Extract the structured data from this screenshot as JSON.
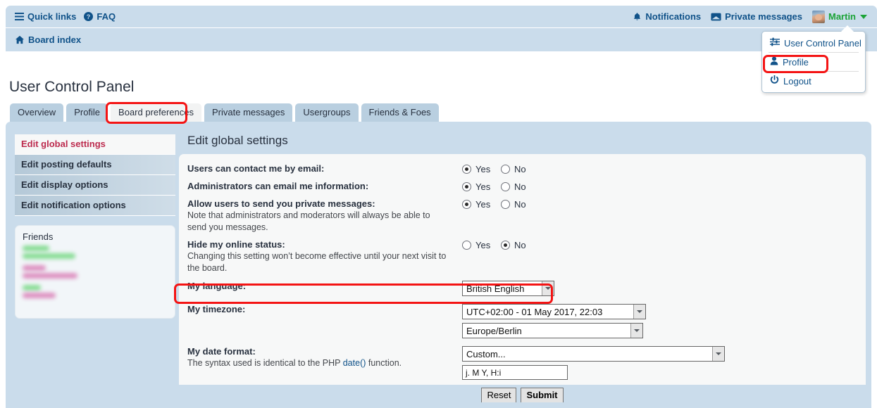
{
  "navbar": {
    "quick_links": "Quick links",
    "faq": "FAQ",
    "notifications": "Notifications",
    "private_messages": "Private messages",
    "username": "Martin",
    "board_index": "Board index"
  },
  "user_menu": {
    "items": [
      {
        "label": "User Control Panel",
        "icon": "sliders-icon"
      },
      {
        "label": "Profile",
        "icon": "user-icon"
      },
      {
        "label": "Logout",
        "icon": "power-icon"
      }
    ]
  },
  "page": {
    "title": "User Control Panel"
  },
  "tabs": [
    {
      "label": "Overview",
      "active": false
    },
    {
      "label": "Profile",
      "active": false
    },
    {
      "label": "Board preferences",
      "active": true
    },
    {
      "label": "Private messages",
      "active": false
    },
    {
      "label": "Usergroups",
      "active": false
    },
    {
      "label": "Friends & Foes",
      "active": false
    }
  ],
  "sidebar": {
    "items": [
      {
        "label": "Edit global settings",
        "active": true
      },
      {
        "label": "Edit posting defaults",
        "active": false
      },
      {
        "label": "Edit display options",
        "active": false
      },
      {
        "label": "Edit notification options",
        "active": false
      }
    ],
    "friends_panel": {
      "title": "Friends"
    }
  },
  "content": {
    "header": "Edit global settings",
    "radio_yes": "Yes",
    "radio_no": "No",
    "rows": {
      "contact_email": {
        "label": "Users can contact me by email:",
        "value": "Yes"
      },
      "admin_email": {
        "label": "Administrators can email me information:",
        "value": "Yes"
      },
      "allow_pm": {
        "label": "Allow users to send you private messages:",
        "desc": "Note that administrators and moderators will always be able to send you messages.",
        "value": "Yes"
      },
      "hide_online": {
        "label": "Hide my online status:",
        "desc": "Changing this setting won’t become effective until your next visit to the board.",
        "value": "No"
      },
      "language": {
        "label": "My language:",
        "value": "British English"
      },
      "timezone": {
        "label": "My timezone:",
        "value": "UTC+02:00 - 01 May 2017, 22:03",
        "region_value": "Europe/Berlin"
      },
      "date_format": {
        "label": "My date format:",
        "desc_before": "The syntax used is identical to the PHP ",
        "desc_link": "date()",
        "desc_after": " function.",
        "value": "Custom...",
        "custom_value": "j. M Y, H:i"
      }
    },
    "buttons": {
      "reset": "Reset",
      "submit": "Submit"
    }
  },
  "colors": {
    "header_blue": "#cadceb",
    "link_blue": "#105289",
    "username_green": "#1ba337",
    "active_sidebar_red": "#bc2a4d",
    "annotation_red": "#f41414"
  }
}
